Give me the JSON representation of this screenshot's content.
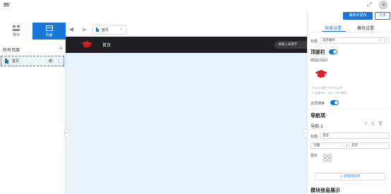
{
  "topbar": {
    "menu_icon": "menu-icon",
    "expand_icon": "expand-icon",
    "avatar": "avatar"
  },
  "left_panel": {
    "tabs": [
      {
        "label": "模块",
        "icon": "module-icon",
        "active": false
      },
      {
        "label": "页面",
        "icon": "page-icon",
        "active": true
      }
    ],
    "heading": "所有页面",
    "add_icon": "plus-icon",
    "pages": [
      {
        "label": "首页",
        "icon": "file-icon"
      }
    ]
  },
  "canvas": {
    "tabs": [
      {
        "label": "首页",
        "close": "×"
      }
    ],
    "preview": {
      "nav_label": "首页",
      "search_placeholder": "请输入关键字",
      "logo_icon": "graduation-cap-icon"
    },
    "collapse_left": "‹",
    "collapse_right": "›"
  },
  "right_panel": {
    "save_button": "保存并发布",
    "share_button": "分享",
    "tabs": [
      {
        "label": "项目设置",
        "active": true
      },
      {
        "label": "模块设置",
        "active": false
      }
    ],
    "title_label": "标题",
    "title_value": "首页展示",
    "title_counter": "4 / 15",
    "topbar_section": "顶部栏",
    "topbar_enabled": true,
    "logo_label": "网站LOGO",
    "logo_hints": [
      "1.LOGO图片大小5M以内",
      "2.支持PNG、JPG、JPEG格式"
    ],
    "global_search_label": "全局搜索",
    "global_search_enabled": true,
    "nav_section": "导航项",
    "nav_item_title": "导航-1",
    "nav_title_label": "标题",
    "nav_title_value": "首页",
    "nav_type_value": "页面",
    "nav_target_value": "首页",
    "icon_label": "图标",
    "add_nav_button": "+ 新增导航项",
    "module_section": "模块信息展示",
    "accent_color": "#1677d9"
  }
}
